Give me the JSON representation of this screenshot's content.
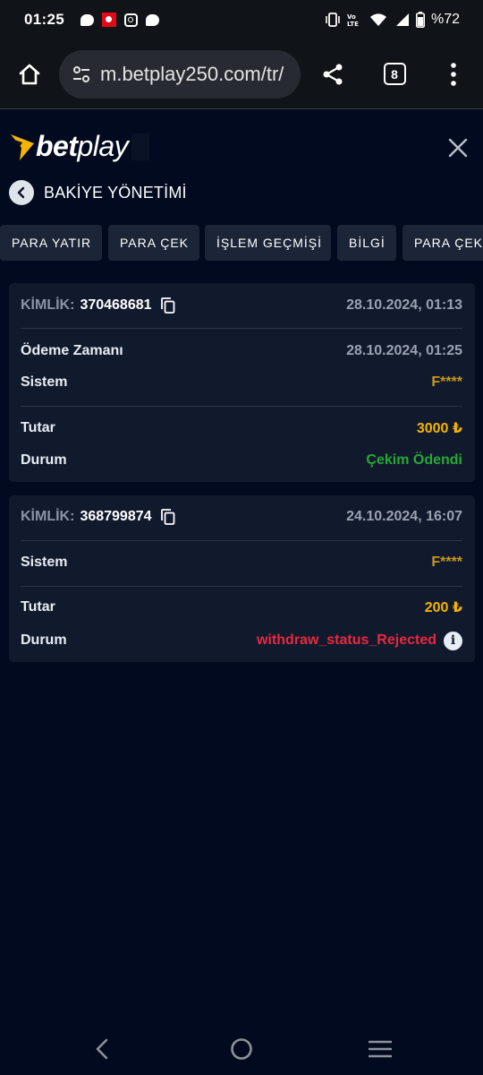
{
  "status_bar": {
    "time": "01:25",
    "battery": "%72",
    "icons": [
      "message-bubble-icon",
      "turkish-flag-icon",
      "instagram-icon",
      "message-bubble-icon",
      "vibrate-icon",
      "volte-icon",
      "wifi-icon",
      "signal-icon",
      "battery-icon"
    ]
  },
  "browser": {
    "url": "m.betplay250.com/tr/",
    "tab_count": "8"
  },
  "header": {
    "logo_bet": "bet",
    "logo_play": "play",
    "title": "BAKİYE YÖNETİMİ"
  },
  "tabs": [
    {
      "label": "PARA YATIR"
    },
    {
      "label": "PARA ÇEK"
    },
    {
      "label": "İŞLEM GEÇMİŞİ"
    },
    {
      "label": "BİLGİ"
    },
    {
      "label": "PARA ÇEKME"
    }
  ],
  "transactions": [
    {
      "id_label": "KİMLİK:",
      "id": "370468681",
      "date": "28.10.2024, 01:13",
      "payment_time_label": "Ödeme Zamanı",
      "payment_time": "28.10.2024, 01:25",
      "system_label": "Sistem",
      "system": "F****",
      "amount_label": "Tutar",
      "amount": "3000 ₺",
      "status_label": "Durum",
      "status": "Çekim Ödendi",
      "status_color": "#26a836"
    },
    {
      "id_label": "KİMLİK:",
      "id": "368799874",
      "date": "24.10.2024, 16:07",
      "system_label": "Sistem",
      "system": "F****",
      "amount_label": "Tutar",
      "amount": "200 ₺",
      "status_label": "Durum",
      "status": "withdraw_status_Rejected",
      "status_color": "#e8283e"
    }
  ],
  "colors": {
    "background": "#020a1f",
    "card": "#111a2d",
    "accent": "#f5b400"
  }
}
